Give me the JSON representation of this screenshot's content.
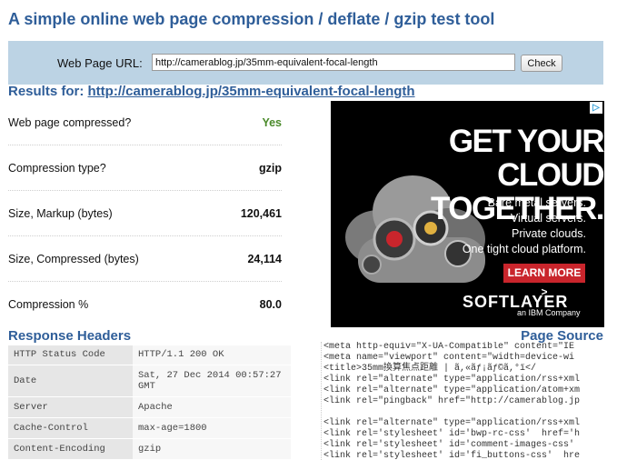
{
  "page": {
    "title": "A simple online web page compression / deflate / gzip test tool"
  },
  "form": {
    "url_label": "Web Page URL:",
    "url_value": "http://camerablog.jp/35mm-equivalent-focal-length",
    "check_button": "Check"
  },
  "results": {
    "prefix": "Results for:",
    "url": "http://camerablog.jp/35mm-equivalent-focal-length",
    "rows": [
      {
        "label": "Web page compressed?",
        "value": "Yes"
      },
      {
        "label": "Compression type?",
        "value": "gzip"
      },
      {
        "label": "Size, Markup (bytes)",
        "value": "120,461"
      },
      {
        "label": "Size, Compressed (bytes)",
        "value": "24,114"
      },
      {
        "label": "Compression %",
        "value": "80.0"
      }
    ]
  },
  "ad": {
    "choices_icon": "ad-choices-icon",
    "headline_line1": "GET YOUR CLOUD",
    "headline_line2": "TOGETHER.",
    "lines": [
      "Bare metal servers.",
      "Virtual servers.",
      "Private clouds.",
      "One tight cloud platform."
    ],
    "cta": "LEARN MORE >",
    "brand": "SOFTLAYER",
    "brand_sub": "an IBM Company",
    "colors": {
      "cta": "#c9252c",
      "background": "#000000"
    }
  },
  "response_headers": {
    "heading": "Response Headers",
    "rows": [
      {
        "key": "HTTP Status Code",
        "value": "HTTP/1.1 200 OK"
      },
      {
        "key": "Date",
        "value": "Sat, 27 Dec 2014 00:57:27 GMT"
      },
      {
        "key": "Server",
        "value": "Apache"
      },
      {
        "key": "Cache-Control",
        "value": "max-age=1800"
      },
      {
        "key": "Content-Encoding",
        "value": "gzip"
      }
    ]
  },
  "page_source": {
    "heading": "Page Source",
    "lines": [
      "<meta http-equiv=\"X-UA-Compatible\" content=\"IE",
      "<meta name=\"viewport\" content=\"width=device-wi",
      "<title>35mm換算焦点距離 | ã,«ãƒ¡ãƒ©ã,°ï</",
      "<link rel=\"alternate\" type=\"application/rss+xml",
      "<link rel=\"alternate\" type=\"application/atom+xm",
      "<link rel=\"pingback\" href=\"http://camerablog.jp",
      "",
      "<link rel=\"alternate\" type=\"application/rss+xml",
      "<link rel='stylesheet' id='bwp-rc-css'  href='h",
      "<link rel='stylesheet' id='comment-images-css'",
      "<link rel='stylesheet' id='fi_buttons-css'  hre"
    ]
  }
}
